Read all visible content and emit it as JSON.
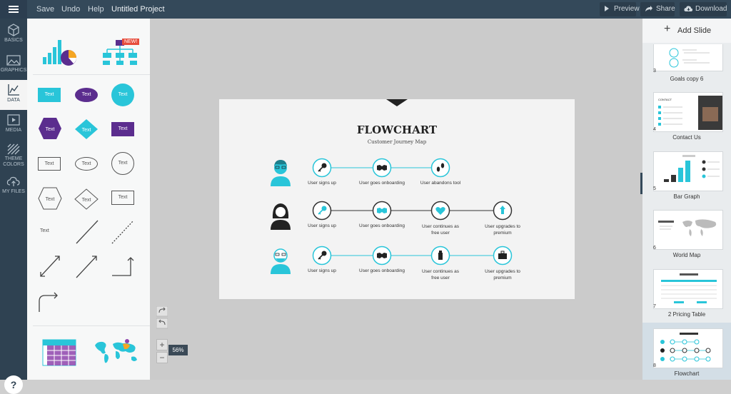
{
  "topbar": {
    "save": "Save",
    "undo": "Undo",
    "help": "Help",
    "project_title": "Untitled Project",
    "preview": "Preview",
    "share": "Share",
    "download": "Download"
  },
  "leftnav": {
    "items": [
      {
        "label": "BASICS",
        "icon": "cube-icon"
      },
      {
        "label": "GRAPHICS",
        "icon": "image-icon"
      },
      {
        "label": "DATA",
        "icon": "chart-icon",
        "active": true
      },
      {
        "label": "MEDIA",
        "icon": "play-icon"
      },
      {
        "label": "THEME COLORS",
        "icon": "stripes-icon"
      },
      {
        "label": "MY FILES",
        "icon": "cloud-upload-icon"
      }
    ],
    "help": "?"
  },
  "panel": {
    "new_badge": "NEW!",
    "shape_text": "Text"
  },
  "zoom": {
    "value": "56%",
    "plus": "+",
    "minus": "−"
  },
  "slide": {
    "title": "FLOWCHART",
    "subtitle": "Customer Journey Map",
    "rows": [
      {
        "steps": [
          "User signs up",
          "User goes onboarding",
          "User abandons tool"
        ]
      },
      {
        "steps": [
          "User signs up",
          "User goes onboarding",
          "User continues as free user",
          "User upgrades to premium"
        ]
      },
      {
        "steps": [
          "User signs up",
          "User goes onboarding",
          "User continues as free user",
          "User upgrades to premium"
        ]
      }
    ],
    "accent": "#29c5d9"
  },
  "rightpanel": {
    "add_slide": "Add Slide",
    "slides": [
      {
        "num": "3",
        "label": "Goals copy 6"
      },
      {
        "num": "4",
        "label": "Contact Us"
      },
      {
        "num": "5",
        "label": "Bar Graph"
      },
      {
        "num": "6",
        "label": "World Map"
      },
      {
        "num": "7",
        "label": "2 Pricing Table"
      },
      {
        "num": "8",
        "label": "Flowchart"
      }
    ]
  }
}
